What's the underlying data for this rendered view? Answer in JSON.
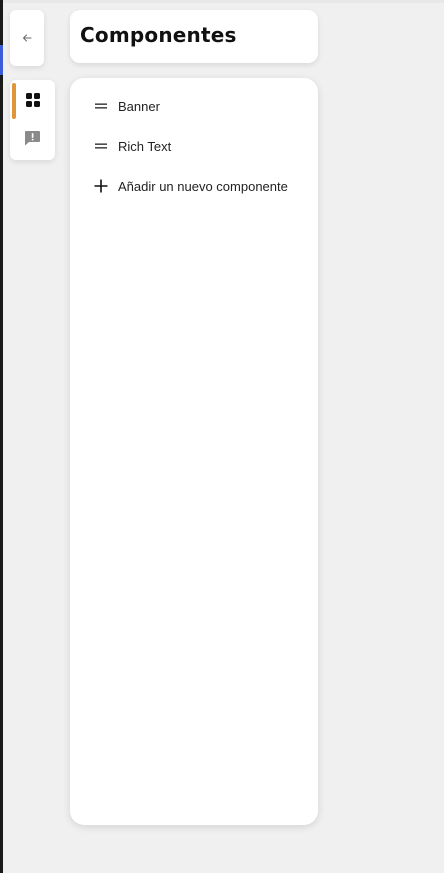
{
  "header": {
    "title": "Componentes"
  },
  "components": [
    {
      "label": "Banner",
      "icon": "drag-handle-icon"
    },
    {
      "label": "Rich Text",
      "icon": "drag-handle-icon"
    }
  ],
  "add_component": {
    "label": "Añadir un nuevo componente",
    "icon": "plus-icon"
  },
  "rail": [
    {
      "icon": "grid-icon",
      "active": true
    },
    {
      "icon": "feedback-icon",
      "active": false
    }
  ],
  "back": {
    "icon": "arrow-left-icon"
  },
  "colors": {
    "background": "#f0f0f0",
    "card": "#ffffff",
    "active_indicator": "#e0953a",
    "text": "#222222",
    "title": "#111111",
    "icon_muted": "#8a8a8a"
  }
}
